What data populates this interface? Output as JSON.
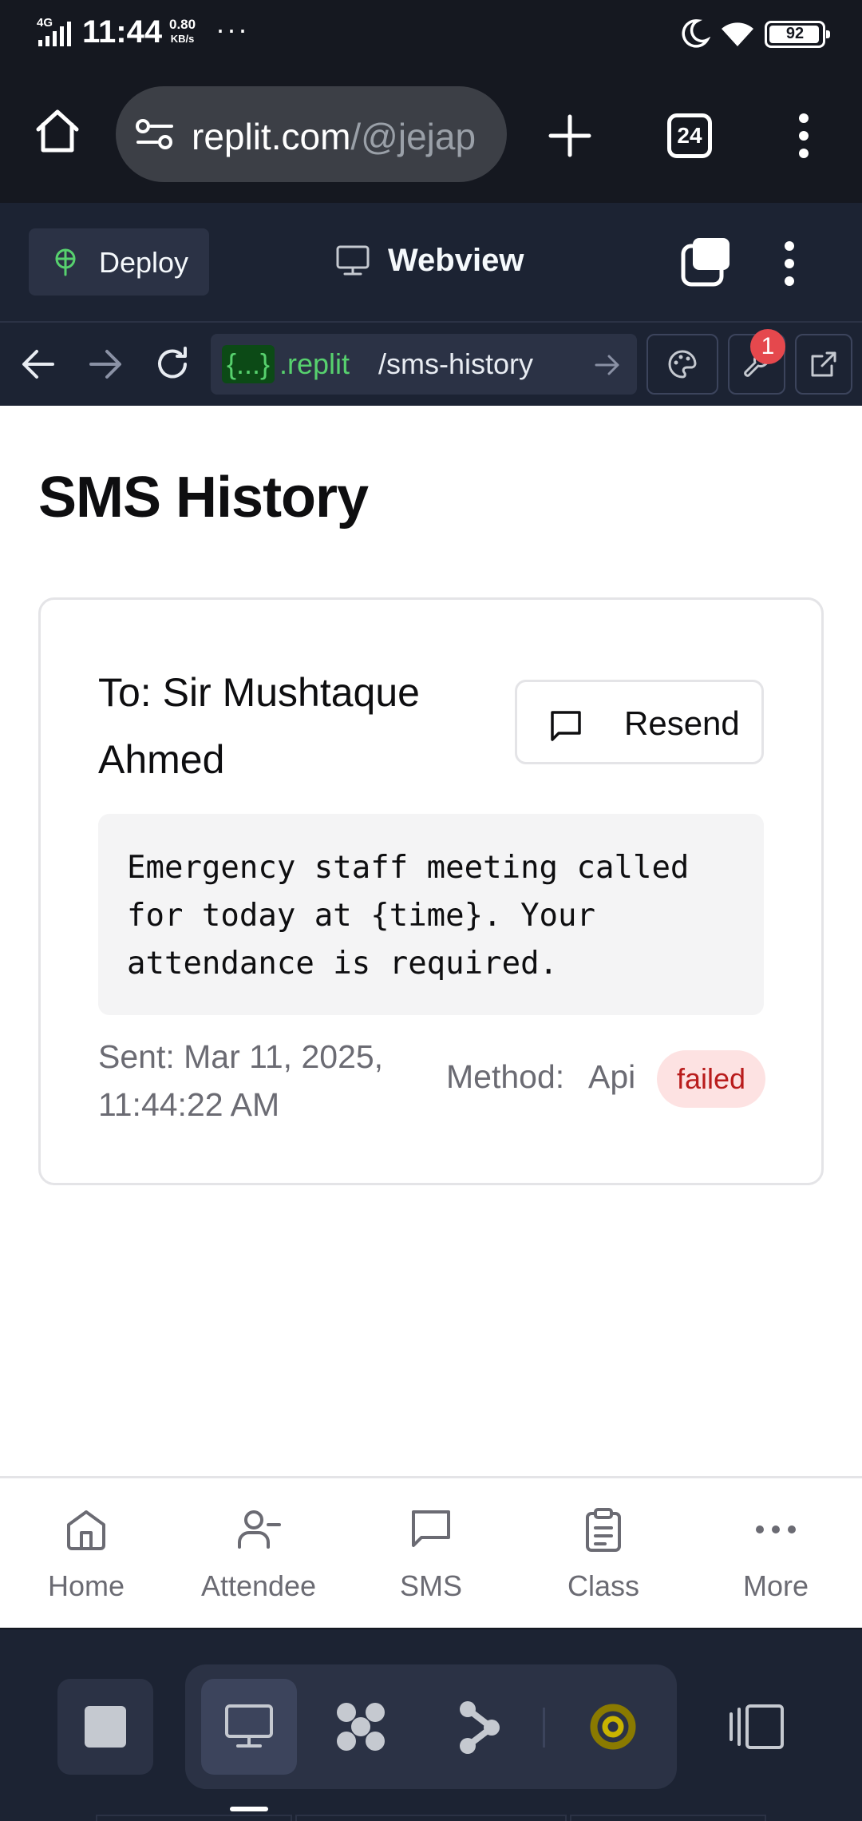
{
  "status_bar": {
    "network": "4G",
    "time": "11:44",
    "speed_value": "0.80",
    "speed_unit": "KB/s",
    "overflow": "···",
    "battery": "92"
  },
  "browser": {
    "url_host": "replit.com",
    "url_path": "/@jejap",
    "tab_count": "24"
  },
  "replit": {
    "deploy_label": "Deploy",
    "webview_label": "Webview",
    "addr_tag": "{...}",
    "addr_domain": ".replit",
    "addr_path": "/sms-history",
    "badge_count": "1"
  },
  "page": {
    "title": "SMS History",
    "card": {
      "recipient": "To: Sir Mushtaque Ahmed",
      "resend_label": "Resend",
      "message": "Emergency staff meeting called for today at {time}. Your attendance is required.",
      "sent": "Sent: Mar 11, 2025, 11:44:22 AM",
      "method_label": "Method:",
      "method_value": "Api",
      "status": "failed"
    }
  },
  "app_nav": {
    "items": [
      {
        "label": "Home",
        "icon": "home-icon"
      },
      {
        "label": "Attendee",
        "icon": "user-minus-icon"
      },
      {
        "label": "SMS",
        "icon": "message-square-icon"
      },
      {
        "label": "Class",
        "icon": "clipboard-icon"
      },
      {
        "label": "More",
        "icon": "more-horizontal-icon"
      }
    ]
  },
  "colors": {
    "status_failed_bg": "#fde2e2",
    "status_failed_text": "#b91c1c",
    "replit_bg": "#1c2333",
    "replit_accent_green": "#57d16e"
  }
}
